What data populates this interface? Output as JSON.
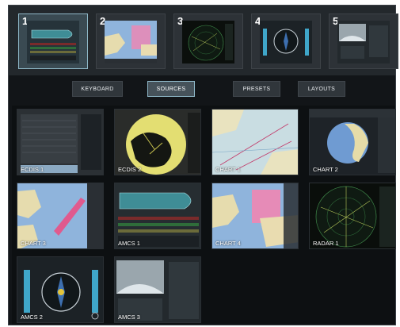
{
  "displays": [
    {
      "number": "1",
      "thumbnail": "ship-overview",
      "active": true
    },
    {
      "number": "2",
      "thumbnail": "chart"
    },
    {
      "number": "3",
      "thumbnail": "radar"
    },
    {
      "number": "4",
      "thumbnail": "compass"
    },
    {
      "number": "5",
      "thumbnail": "camera"
    }
  ],
  "tabs": [
    {
      "label": "KEYBOARD"
    },
    {
      "label": "SOURCES",
      "active": true
    },
    {
      "label": "PRESETS"
    },
    {
      "label": "LAYOUTS"
    }
  ],
  "sources": [
    {
      "label": "ECDIS 1",
      "thumbnail": "ecdis-list"
    },
    {
      "label": "ECDIS 2",
      "thumbnail": "ecdis-radar"
    },
    {
      "label": "CHART 1",
      "thumbnail": "chart-pale"
    },
    {
      "label": "CHART 2",
      "thumbnail": "chart-globe"
    },
    {
      "label": "CHART 3",
      "thumbnail": "chart-blue"
    },
    {
      "label": "AMCS 1",
      "thumbnail": "ship-overview"
    },
    {
      "label": "CHART 4",
      "thumbnail": "chart-pink"
    },
    {
      "label": "RADAR 1",
      "thumbnail": "radar"
    },
    {
      "label": "AMCS 2",
      "thumbnail": "compass"
    },
    {
      "label": "AMCS 3",
      "thumbnail": "camera"
    }
  ],
  "colors": {
    "accent": "#8fb8c8",
    "background": "#121518",
    "tile_label": "#ffffff"
  }
}
